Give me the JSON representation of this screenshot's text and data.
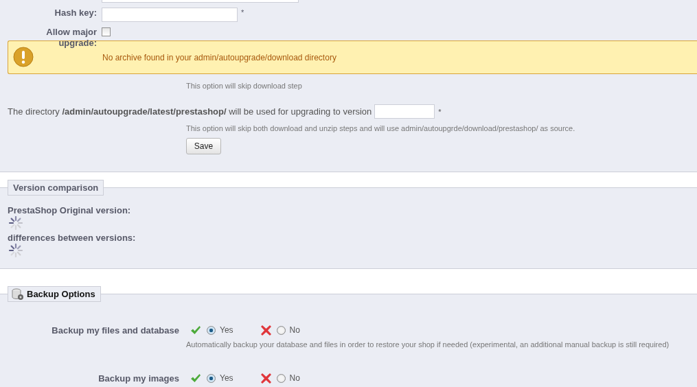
{
  "settings": {
    "fields": [
      {
        "label": "Hash key:",
        "kind": "text",
        "required": "*"
      },
      {
        "label": "Allow major upgrade:",
        "kind": "checkbox",
        "checked": false
      }
    ]
  },
  "warning": {
    "message": "No archive found in your admin/autoupgrade/download directory"
  },
  "skip_download_hint": "This option will skip download step",
  "directory": {
    "sentence": "The directory **/admin/autoupgrade/latest/prestashop/** will be used for upgrading to version",
    "required": "*",
    "hint": "This option will skip both download and unzip steps and will use admin/autoupgrde/download/prestashop/ as source."
  },
  "save_button": "Save",
  "version_comparison": {
    "legend": "Version comparison",
    "items": [
      {
        "label": "PrestaShop Original version:",
        "loading": true
      },
      {
        "label": "differences between versions:",
        "loading": true
      }
    ]
  },
  "backup": {
    "legend": "Backup Options",
    "options": [
      {
        "label": "Backup my files and database",
        "choices": [
          {
            "kind": "yes",
            "label": "Yes",
            "selected": true
          },
          {
            "kind": "no",
            "label": "No",
            "selected": false
          }
        ],
        "hint": "Automatically backup your database and files in order to restore your shop if needed (experimental, an additional manual backup is still required)"
      },
      {
        "label": "Backup my images",
        "choices": [
          {
            "kind": "yes",
            "label": "Yes",
            "selected": true
          },
          {
            "kind": "no",
            "label": "No",
            "selected": false
          }
        ]
      }
    ]
  }
}
